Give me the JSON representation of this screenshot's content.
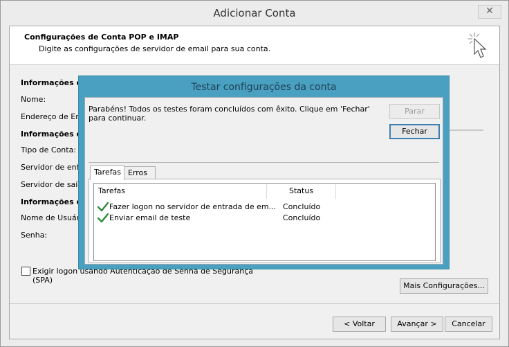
{
  "window": {
    "title": "Adicionar Conta",
    "close_glyph": "✕"
  },
  "header": {
    "title": "Configurações de Conta POP e IMAP",
    "subtitle": "Digite as configurações de servidor de email para sua conta."
  },
  "background_form": {
    "section_user": "Informações do",
    "name_label": "Nome:",
    "email_label": "Endereço de Em",
    "section_server": "Informações do",
    "account_type_label": "Tipo de Conta:",
    "incoming_label": "Servidor de entr",
    "outgoing_label": "Servidor de saíd",
    "section_logon": "Informações de",
    "username_label": "Nome de Usuári",
    "password_label": "Senha:",
    "spa_label": "Exigir logon usando Autenticação de Senha de Segurança (SPA)",
    "more_settings_button": "Mais Configurações..."
  },
  "footer": {
    "back_button": "< Voltar",
    "next_button": "Avançar >",
    "cancel_button": "Cancelar"
  },
  "test_dialog": {
    "title": "Testar configurações da conta",
    "message": "Parabéns! Todos os testes foram concluídos com êxito. Clique em 'Fechar' para continuar.",
    "stop_button": "Parar",
    "close_button": "Fechar",
    "tabs": [
      {
        "label": "Tarefas",
        "active": true
      },
      {
        "label": "Erros",
        "active": false
      }
    ],
    "columns": [
      "Tarefas",
      "Status"
    ],
    "tasks": [
      {
        "name": "Fazer logon no servidor de entrada de em...",
        "status": "Concluído",
        "icon": "check-icon"
      },
      {
        "name": "Enviar email de teste",
        "status": "Concluído",
        "icon": "check-icon"
      }
    ]
  },
  "colors": {
    "dialog_frame": "#4aa0c0",
    "check_green": "#2e8b3a"
  }
}
